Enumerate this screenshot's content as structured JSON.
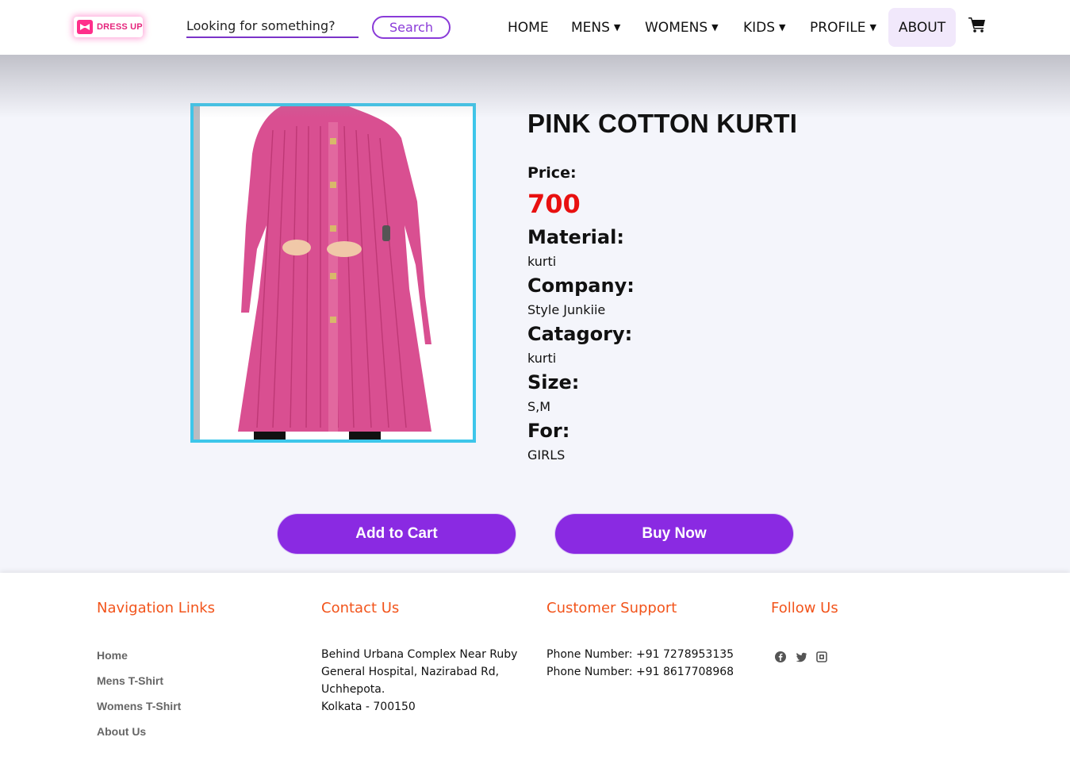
{
  "brand": {
    "name": "DRESS UP",
    "color": "#e5257c"
  },
  "search": {
    "placeholder": "Looking for something?",
    "button_label": "Search"
  },
  "nav": {
    "items": [
      {
        "label": "HOME",
        "has_dropdown": false
      },
      {
        "label": "MENS",
        "has_dropdown": true
      },
      {
        "label": "WOMENS",
        "has_dropdown": true
      },
      {
        "label": "KIDS",
        "has_dropdown": true
      },
      {
        "label": "PROFILE",
        "has_dropdown": true
      },
      {
        "label": "ABOUT",
        "has_dropdown": false,
        "active": true
      }
    ],
    "cart_icon": "shopping-cart-icon"
  },
  "product": {
    "title": "PINK COTTON KURTI",
    "price_label": "Price:",
    "price": "700",
    "attributes": [
      {
        "label": "Material:",
        "value": "kurti"
      },
      {
        "label": "Company:",
        "value": "Style Junkiie"
      },
      {
        "label": "Catagory:",
        "value": "kurti"
      },
      {
        "label": "Size:",
        "value": "S,M"
      },
      {
        "label": "For:",
        "value": "GIRLS"
      }
    ],
    "image_color": "#d94f91",
    "frame_color": "#3dc6ea"
  },
  "actions": {
    "add_to_cart": "Add to Cart",
    "buy_now": "Buy Now",
    "accent": "#8a2ae2"
  },
  "footer": {
    "accent": "#f2541b",
    "navigation": {
      "heading": "Navigation Links",
      "links": [
        "Home",
        "Mens T-Shirt",
        "Womens T-Shirt",
        "About Us"
      ]
    },
    "contact": {
      "heading": "Contact Us",
      "lines": [
        "Behind Urbana Complex Near Ruby",
        "General Hospital, Nazirabad Rd,",
        "Uchhepota.",
        "Kolkata - 700150"
      ]
    },
    "support": {
      "heading": "Customer Support",
      "lines": [
        "Phone Number: +91 7278953135",
        "Phone Number: +91 8617708968"
      ]
    },
    "follow": {
      "heading": "Follow Us",
      "icons": [
        "facebook-icon",
        "twitter-icon",
        "instagram-icon"
      ]
    }
  }
}
